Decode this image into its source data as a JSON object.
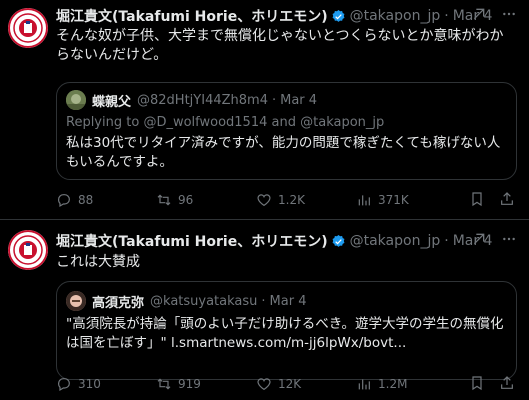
{
  "tweets": [
    {
      "author_name": "堀江貴文(Takafumi Horie、ホリエモン)",
      "handle": "@takapon_jp",
      "date": "Mar 4",
      "text": "そんな奴が子供、大学まで無償化じゃないとつくらないとか意味がわからないんだけど。",
      "quote": {
        "author_name": "蝶親父",
        "handle": "@82dHtjYI44Zh8m4",
        "date": "Mar 4",
        "replying_prefix": "Replying to",
        "replying_mention_1": "@D_wolfwood1514",
        "replying_and": "and",
        "replying_mention_2": "@takapon_jp",
        "text": "私は30代でリタイア済みですが、能力の問題で稼ぎたくても稼げない人もいるんですよ。"
      },
      "stats": {
        "replies": "88",
        "retweets": "96",
        "likes": "1.2K",
        "views": "371K"
      }
    },
    {
      "author_name": "堀江貴文(Takafumi Horie、ホリエモン)",
      "handle": "@takapon_jp",
      "date": "Mar 4",
      "text": "これは大賛成",
      "quote": {
        "author_name": "高須克弥",
        "handle": "@katsuyatakasu",
        "date": "Mar 4",
        "text": "\"高須院長が持論「頭のよい子だけ助けるべき。遊学大学の学生の無償化は国を亡ぼす」\"",
        "link": "l.smartnews.com/m-jj6lpWx/bovt..."
      },
      "stats": {
        "replies": "310",
        "retweets": "919",
        "likes": "12K",
        "views": "1.2M"
      }
    }
  ],
  "colors": {
    "background": "#000000",
    "text": "#e7e9ea",
    "muted": "#71767b",
    "border": "#2f3336",
    "verified": "#1d9bf0",
    "avatar_red": "#c8102e"
  },
  "icons": [
    "verified-badge-icon",
    "grok-icon",
    "more-icon",
    "reply-icon",
    "retweet-icon",
    "like-icon",
    "views-icon",
    "bookmark-icon",
    "share-icon"
  ]
}
